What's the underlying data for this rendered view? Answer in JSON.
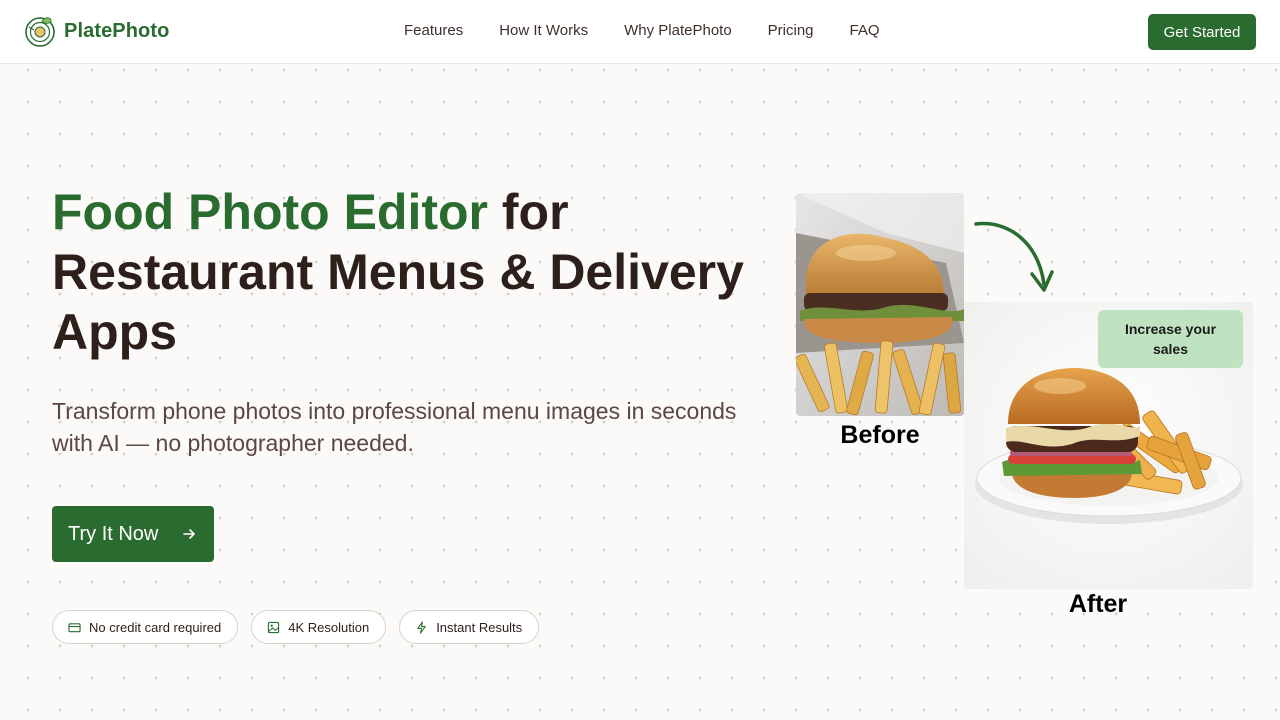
{
  "header": {
    "brand": "PlatePhoto",
    "nav": [
      "Features",
      "How It Works",
      "Why PlatePhoto",
      "Pricing",
      "FAQ"
    ],
    "cta": "Get Started"
  },
  "hero": {
    "title_accent": "Food Photo Editor",
    "title_rest": " for Restaurant Menus & Delivery Apps",
    "subtitle": "Transform phone photos into professional menu images in seconds with AI — no photographer needed.",
    "cta": "Try It Now",
    "badges": [
      {
        "icon": "credit-card-icon",
        "label": "No credit card required"
      },
      {
        "icon": "image-icon",
        "label": "4K Resolution"
      },
      {
        "icon": "lightning-icon",
        "label": "Instant Results"
      }
    ]
  },
  "visual": {
    "before_label": "Before",
    "after_label": "After",
    "tag": "Increase your sales"
  },
  "colors": {
    "brand_green": "#2a6b2f",
    "heading_dark": "#2d1f1a",
    "tag_bg": "#bfe3c0"
  }
}
